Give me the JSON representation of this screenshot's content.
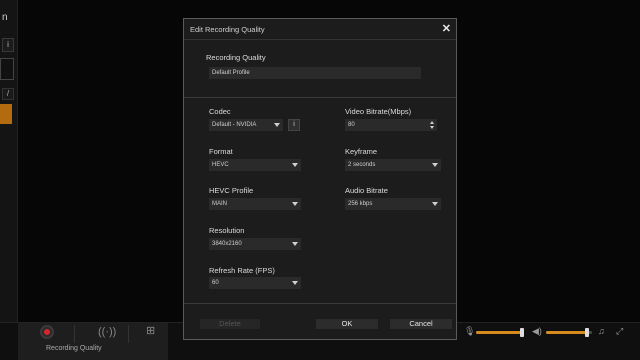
{
  "background": {
    "left_text": "n",
    "left_box1": "i",
    "left_box3": "/",
    "recording_label": "Recording Quality",
    "recording_sub": ""
  },
  "dialog": {
    "title": "Edit Recording Quality",
    "close_symbol": "✕",
    "quality_label": "Recording Quality",
    "profile_name": "Default Profile",
    "codec": {
      "label": "Codec",
      "value": "Default - NVIDIA",
      "info": "i"
    },
    "format": {
      "label": "Format",
      "value": "HEVC"
    },
    "hevc_profile": {
      "label": "HEVC Profile",
      "value": "MAIN"
    },
    "resolution": {
      "label": "Resolution",
      "value": "3840x2160"
    },
    "refresh_rate": {
      "label": "Refresh Rate (FPS)",
      "value": "60"
    },
    "video_bitrate": {
      "label": "Video Bitrate(Mbps)",
      "value": "80"
    },
    "keyframe": {
      "label": "Keyframe",
      "value": "2 seconds"
    },
    "audio_bitrate": {
      "label": "Audio Bitrate",
      "value": "256 kbps"
    },
    "delete_label": "Delete",
    "ok_label": "OK",
    "cancel_label": "Cancel"
  },
  "audio": {
    "mic_level": 0.95,
    "speaker_level": 0.9
  },
  "colors": {
    "accent": "#d68b1f",
    "record_red": "#d9262c",
    "dialog_bg": "#1c1c1c"
  }
}
